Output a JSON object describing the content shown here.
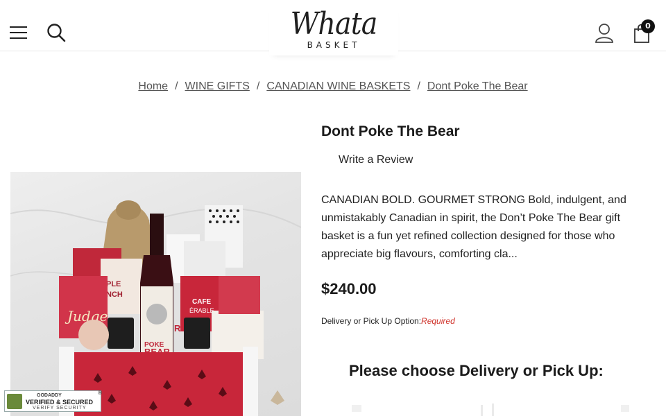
{
  "header": {
    "logo_script": "Whata",
    "logo_sub": "BASKET",
    "cart_count": "0"
  },
  "breadcrumb": {
    "items": [
      "Home",
      "WINE GIFTS",
      "CANADIAN WINE BASKETS",
      "Dont Poke The Bear"
    ],
    "separator": "/"
  },
  "product": {
    "title": "Dont Poke The Bear",
    "review_link": "Write a Review",
    "description": "CANADIAN BOLD. GOURMET STRONG Bold, indulgent, and unmistakably Canadian in spirit, the Don’t Poke The Bear gift basket is a fun yet refined collection designed for those who appreciate big flavours, comforting cla...",
    "price": "$240.00",
    "option_label": "Delivery or Pick Up Option:",
    "option_required": "Required",
    "choose_heading": "Please choose Delivery or Pick Up:"
  },
  "image_labels": {
    "judge": "Judge",
    "maple_crunch_1": "PLE",
    "maple_crunch_2": "NCH",
    "wine_1": "POKE",
    "wine_2": "BEAR",
    "wine_3": "RED",
    "cafe_1": "CAFE",
    "cafe_2": "ÉRABLE"
  },
  "seal": {
    "brand": "GODADDY",
    "line1": "VERIFIED & SECURED",
    "line2": "VERIFY SECURITY"
  },
  "colors": {
    "required": "#d0342c",
    "basket_red": "#c8263a",
    "text": "#1b1b1b"
  }
}
